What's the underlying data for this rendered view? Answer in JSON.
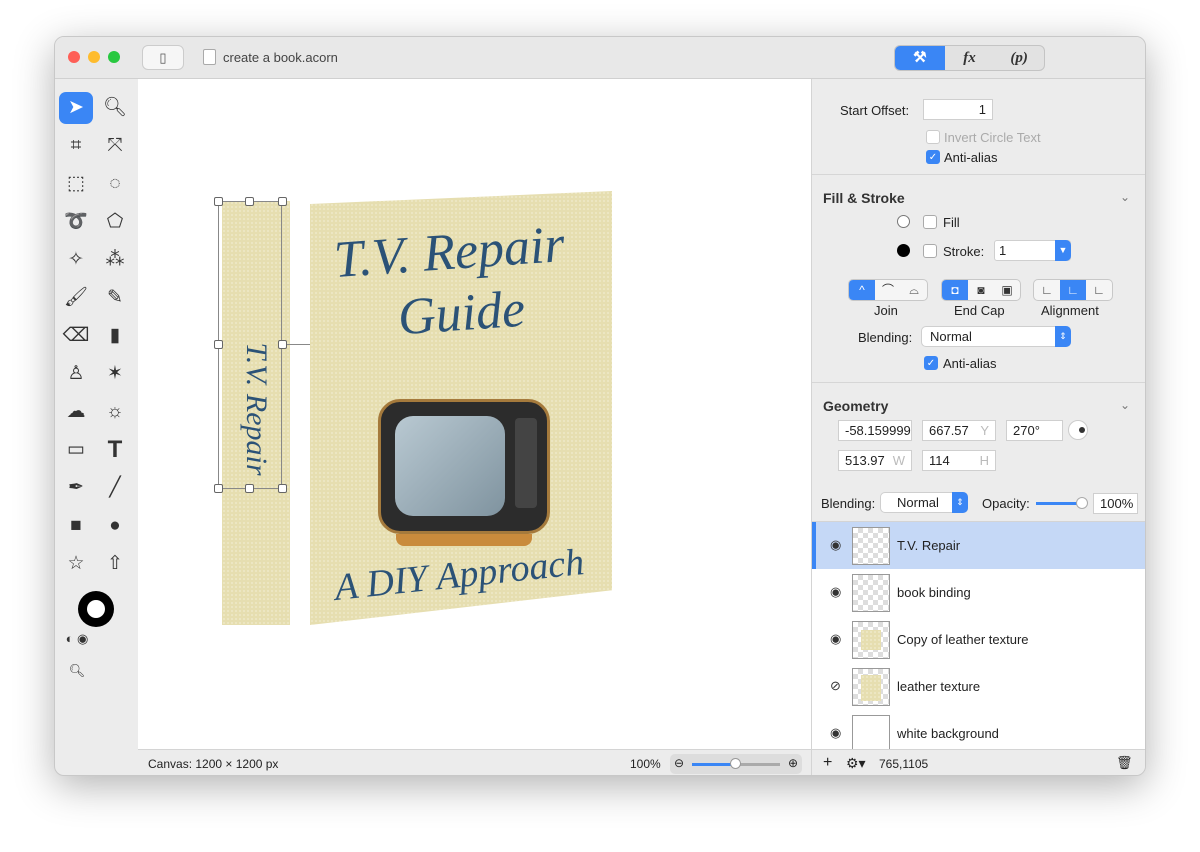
{
  "window": {
    "title": "create a book.acorn"
  },
  "inspector_tabs": [
    {
      "label": "tools-icon",
      "active": true
    },
    {
      "label": "fx"
    },
    {
      "label": "(p)"
    }
  ],
  "text_props": {
    "start_offset_label": "Start Offset:",
    "start_offset": "1",
    "invert_circle_text": "Invert Circle Text",
    "anti_alias": "Anti-alias"
  },
  "fill_stroke": {
    "title": "Fill & Stroke",
    "fill": "Fill",
    "stroke": "Stroke:",
    "stroke_width": "1",
    "join": "Join",
    "end_cap": "End Cap",
    "alignment": "Alignment",
    "blending_label": "Blending:",
    "blending": "Normal",
    "anti_alias": "Anti-alias"
  },
  "geometry": {
    "title": "Geometry",
    "x": "-58.159999",
    "y": "667.57",
    "y_unit": "Y",
    "angle": "270°",
    "w": "513.97",
    "w_unit": "W",
    "h": "114",
    "h_unit": "H"
  },
  "layers_bar": {
    "blending_label": "Blending:",
    "blending": "Normal",
    "opacity_label": "Opacity:",
    "opacity": "100%",
    "opacity_value": 1.0
  },
  "layers": [
    {
      "name": "T.V. Repair",
      "visible": true,
      "selected": true
    },
    {
      "name": "book binding",
      "visible": true
    },
    {
      "name": "Copy of leather texture",
      "visible": true
    },
    {
      "name": "leather texture",
      "visible": false
    },
    {
      "name": "white background",
      "visible": true
    }
  ],
  "layers_status": {
    "coords": "765,1105"
  },
  "status": {
    "canvas": "Canvas: 1200 × 1200 px",
    "zoom": "100%",
    "zoom_value": 0.5
  },
  "artwork": {
    "spine_text": "T.V. Repair",
    "title_line1": "T.V. Repair",
    "title_line2": "Guide",
    "subtitle": "A DIY Approach"
  },
  "colors": {
    "accent": "#3a86f5",
    "title_text": "#2b5277",
    "leather": "#e6deb0"
  }
}
